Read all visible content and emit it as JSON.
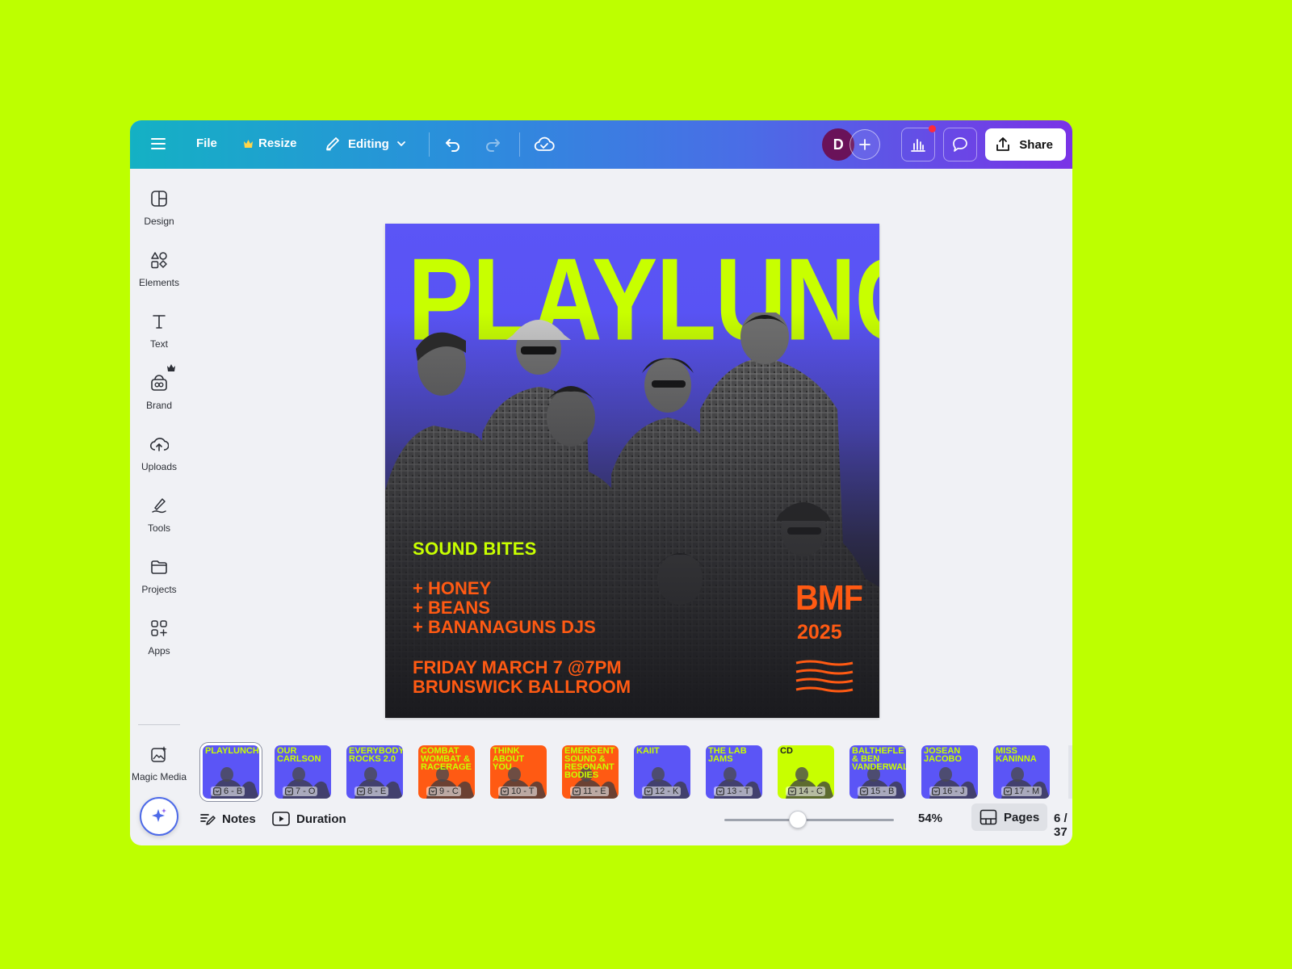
{
  "colors": {
    "accent": "#bdff00",
    "poster_lime": "#c8ff00",
    "poster_orange": "#ff5a13",
    "poster_blue": "#5b55f6"
  },
  "topbar": {
    "menu_icon": "hamburger-icon",
    "file_label": "File",
    "resize_label": "Resize",
    "editing_label": "Editing",
    "avatar_initial": "D",
    "share_label": "Share"
  },
  "sidebar": {
    "items": [
      {
        "label": "Design",
        "icon": "design-icon"
      },
      {
        "label": "Elements",
        "icon": "elements-icon"
      },
      {
        "label": "Text",
        "icon": "text-icon"
      },
      {
        "label": "Brand",
        "icon": "brand-icon"
      },
      {
        "label": "Uploads",
        "icon": "cloud-upload-icon"
      },
      {
        "label": "Tools",
        "icon": "tools-icon"
      },
      {
        "label": "Projects",
        "icon": "folder-icon"
      },
      {
        "label": "Apps",
        "icon": "apps-icon"
      },
      {
        "label": "Magic Media",
        "icon": "magic-media-icon"
      }
    ]
  },
  "poster": {
    "title": "PLAYLUNCH",
    "subtitle": "SOUND BITES",
    "acts": [
      "+ HONEY",
      "+ BEANS",
      "+ BANANAGUNS DJS"
    ],
    "date_line": "FRIDAY MARCH 7 @7PM",
    "venue_line": "BRUNSWICK BALLROOM",
    "badge_title": "BMF",
    "badge_year": "2025"
  },
  "pages": {
    "thumbs": [
      {
        "title": "PLAYLUNCH",
        "label": "6 - B",
        "bg": "#5b55f6"
      },
      {
        "title": "OUR CARLSON",
        "label": "7 - O",
        "bg": "#5b55f6"
      },
      {
        "title": "EVERYBODY ROCKS 2.0",
        "label": "8 - E",
        "bg": "#5b55f6"
      },
      {
        "title": "COMBAT WOMBAT & RACERAGE",
        "label": "9 - C",
        "bg": "#ff5a13"
      },
      {
        "title": "THINK ABOUT YOU",
        "label": "10 - T",
        "bg": "#ff5a13"
      },
      {
        "title": "EMERGENT SOUND & RESONANT BODIES",
        "label": "11 - E",
        "bg": "#ff5a13"
      },
      {
        "title": "KAIIT",
        "label": "12 - K",
        "bg": "#5b55f6"
      },
      {
        "title": "THE LAB JAMS",
        "label": "13 - T",
        "bg": "#5b55f6"
      },
      {
        "title": "CD",
        "label": "14 - C",
        "bg": "#c8ff00"
      },
      {
        "title": "BALTHEFLETCHRIFE & BEN VANDERWAL",
        "label": "15 - B",
        "bg": "#5b55f6"
      },
      {
        "title": "JOSEAN JACOBO",
        "label": "16 - J",
        "bg": "#5b55f6"
      },
      {
        "title": "MISS KANINNA",
        "label": "17 - M",
        "bg": "#5b55f6"
      }
    ]
  },
  "bottombar": {
    "notes_label": "Notes",
    "duration_label": "Duration",
    "zoom": "54%",
    "pages_label": "Pages",
    "page_count": "6 / 37"
  }
}
